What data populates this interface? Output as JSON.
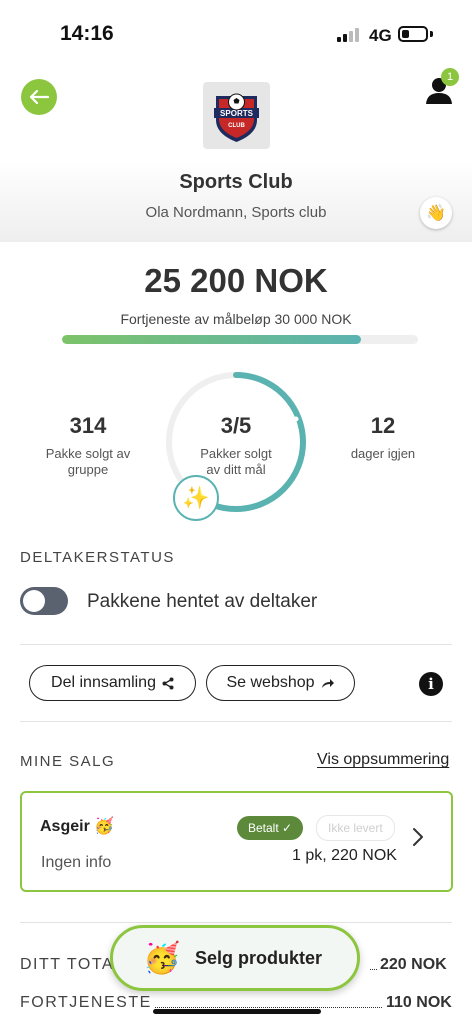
{
  "status_bar": {
    "time": "14:16",
    "network": "4G",
    "battery_level": 0.3
  },
  "header": {
    "notification_count": "1",
    "club_name": "Sports Club",
    "subtitle": "Ola Nordmann, Sports club",
    "logo_text": "SPORTS",
    "logo_subtext": "CLUB"
  },
  "fundraiser": {
    "amount": "25 200 NOK",
    "goal_text": "Fortjeneste av målbeløp 30 000 NOK",
    "progress": 0.84
  },
  "stats": {
    "group_sold": "314",
    "group_sold_label": [
      "Pakke solgt av",
      "gruppe"
    ],
    "my_sold": "3/5",
    "my_sold_label": [
      "Pakker solgt",
      "av ditt mål"
    ],
    "my_progress": 0.6,
    "days_left": "12",
    "days_left_label": "dager igjen"
  },
  "participant": {
    "section_title": "DELTAKERSTATUS",
    "toggle_label": "Pakkene hentet av deltaker",
    "toggle_on": false
  },
  "actions": {
    "share_label": "Del innsamling",
    "webshop_label": "Se webshop"
  },
  "sales": {
    "section_title": "MINE SALG",
    "summary_link": "Vis oppsummering",
    "items": [
      {
        "buyer": "Asgeir 🥳",
        "info": "Ingen info",
        "paid_label": "Betalt ✓",
        "delivered_label": "Ikke levert",
        "quantity": "1 pk, 220 NOK"
      }
    ]
  },
  "totals": {
    "total_label": "DITT TOTA",
    "total_value": "220 NOK",
    "profit_label": "FORTJENESTE",
    "profit_value": "110 NOK"
  },
  "fab": {
    "icon": "🥳",
    "label": "Selg produkter"
  },
  "colors": {
    "accent_green": "#8cc63f",
    "teal": "#5ab3b1",
    "paid_green": "#5c8a3a"
  }
}
